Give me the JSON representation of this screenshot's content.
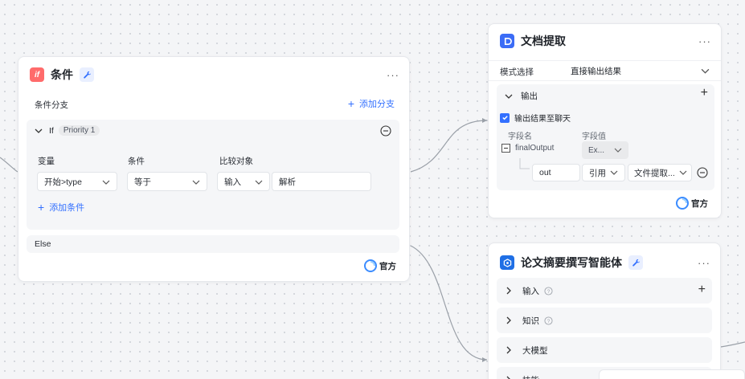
{
  "condition_node": {
    "icon_text": "if",
    "title": "条件",
    "more": "···",
    "branch_label": "条件分支",
    "add_branch": "添加分支",
    "if_label": "If",
    "priority": "Priority 1",
    "col_variable": "变量",
    "col_condition": "条件",
    "col_compare": "比较对象",
    "variable_value": "开始>type",
    "condition_value": "等于",
    "compare_type": "输入",
    "compare_value": "解析",
    "add_condition": "添加条件",
    "else_label": "Else",
    "official": "官方"
  },
  "doc_node": {
    "title": "文档提取",
    "more": "···",
    "mode_label": "模式选择",
    "mode_value": "直接输出结果",
    "output_label": "输出",
    "output_to_chat": "输出结果至聊天",
    "field_name_header": "字段名",
    "field_value_header": "字段值",
    "field_root": "finalOutput",
    "field_root_type": "Ex...",
    "field_child": "out",
    "field_child_ref": "引用",
    "field_child_source": "文件提取...",
    "official": "官方"
  },
  "agent_node": {
    "title": "论文摘要撰写智能体",
    "more": "···",
    "sections": [
      "输入",
      "知识",
      "大模型",
      "技能"
    ]
  },
  "colors": {
    "accent": "#3370ff",
    "if_icon": "#ff6b6b",
    "doc_icon": "#3b6cf6",
    "agent_icon": "#1f6fe5"
  }
}
